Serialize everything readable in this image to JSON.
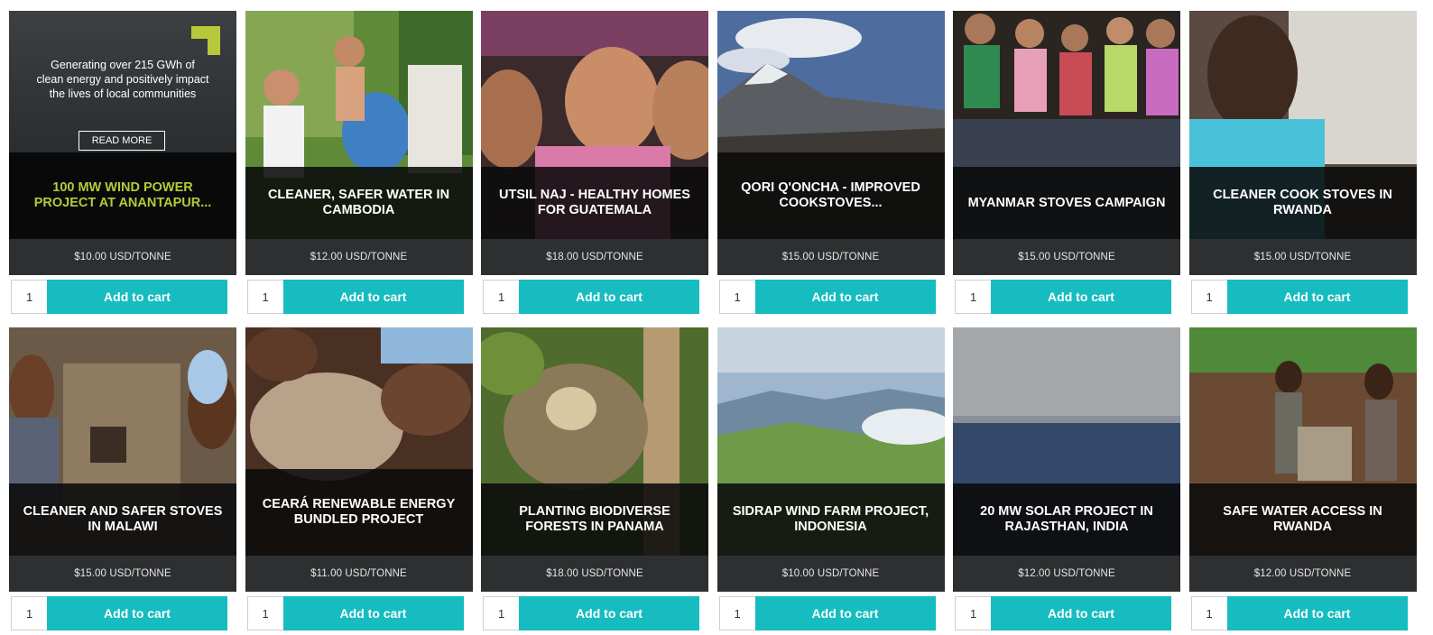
{
  "products": [
    {
      "title": "100 MW WIND POWER PROJECT AT ANANTAPUR...",
      "price": "$10.00 USD/TONNE",
      "qty": "1",
      "button": "Add to cart",
      "hover_text": "Generating over 215 GWh of clean energy and positively impact the lives of local communities",
      "read_more": "READ MORE",
      "image": "wind-dark-photo",
      "accent": "#b7c93a"
    },
    {
      "title": "CLEANER, SAFER WATER IN CAMBODIA",
      "price": "$12.00 USD/TONNE",
      "qty": "1",
      "button": "Add to cart",
      "image": "water-filter-photo"
    },
    {
      "title": "UTSIL NAJ - HEALTHY HOMES FOR GUATEMALA",
      "price": "$18.00 USD/TONNE",
      "qty": "1",
      "button": "Add to cart",
      "image": "children-faces-photo"
    },
    {
      "title": "QORI Q'ONCHA - IMPROVED COOKSTOVES...",
      "price": "$15.00 USD/TONNE",
      "qty": "1",
      "button": "Add to cart",
      "image": "mountain-photo"
    },
    {
      "title": "MYANMAR STOVES CAMPAIGN",
      "price": "$15.00 USD/TONNE",
      "qty": "1",
      "button": "Add to cart",
      "image": "group-photo"
    },
    {
      "title": "CLEANER COOK STOVES IN RWANDA",
      "price": "$15.00 USD/TONNE",
      "qty": "1",
      "button": "Add to cart",
      "image": "smiling-girl-photo"
    },
    {
      "title": "CLEANER AND SAFER STOVES IN MALAWI",
      "price": "$15.00 USD/TONNE",
      "qty": "1",
      "button": "Add to cart",
      "image": "stove-children-photo"
    },
    {
      "title": "CEARÁ RENEWABLE ENERGY BUNDLED PROJECT",
      "price": "$11.00 USD/TONNE",
      "qty": "1",
      "button": "Add to cart",
      "image": "coconut-husks-photo"
    },
    {
      "title": "PLANTING BIODIVERSE FORESTS IN PANAMA",
      "price": "$18.00 USD/TONNE",
      "qty": "1",
      "button": "Add to cart",
      "image": "sloth-photo"
    },
    {
      "title": "SIDRAP WIND FARM PROJECT, INDONESIA",
      "price": "$10.00 USD/TONNE",
      "qty": "1",
      "button": "Add to cart",
      "image": "wind-farm-photo"
    },
    {
      "title": "20 MW SOLAR PROJECT IN RAJASTHAN, INDIA",
      "price": "$12.00 USD/TONNE",
      "qty": "1",
      "button": "Add to cart",
      "image": "solar-panels-photo"
    },
    {
      "title": "SAFE WATER ACCESS IN RWANDA",
      "price": "$12.00 USD/TONNE",
      "qty": "1",
      "button": "Add to cart",
      "image": "water-pump-photo"
    }
  ],
  "colors": {
    "button": "#16bcbf",
    "price_bar": "#2d2f31",
    "title_band": "#0a0a0a"
  }
}
